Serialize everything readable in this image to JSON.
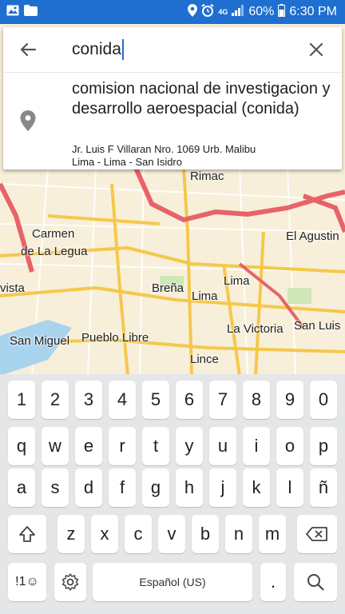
{
  "status_bar": {
    "network": "4G",
    "battery": "60%",
    "time": "6:30 PM",
    "icons": [
      "image-icon",
      "folder-icon",
      "location-icon",
      "alarm-icon",
      "signal-icon",
      "battery-icon"
    ]
  },
  "search": {
    "query": "conida",
    "back_icon": "arrow-left-icon",
    "clear_icon": "close-icon"
  },
  "result": {
    "icon": "location-pin-icon",
    "name": "comision nacional de investigacion y desarrollo aeroespacial (conida)",
    "address_line1": "Jr. Luis F Villaran Nro. 1069 Urb. Malibu",
    "address_line2": "Lima - Lima - San Isidro"
  },
  "map": {
    "labels": {
      "rimac": "Rimac",
      "carmen": "Carmen",
      "de_la_legua": "de La Legua",
      "el_agustin": "El Agustin",
      "vista": "vista",
      "brena": "Breña",
      "lima1": "Lima",
      "lima2": "Lima",
      "san_miguel": "San Miguel",
      "pueblo_libre": "Pueblo Libre",
      "la_victoria": "La Victoria",
      "san_luis": "San Luis",
      "lince": "Lince"
    },
    "colors": {
      "land": "#f7efd9",
      "major_road": "#e8626a",
      "road": "#f5c84b",
      "water": "#a8d4ee"
    }
  },
  "keyboard": {
    "numbers": [
      "1",
      "2",
      "3",
      "4",
      "5",
      "6",
      "7",
      "8",
      "9",
      "0"
    ],
    "row1": [
      "q",
      "w",
      "e",
      "r",
      "t",
      "y",
      "u",
      "i",
      "o",
      "p"
    ],
    "row2": [
      "a",
      "s",
      "d",
      "f",
      "g",
      "h",
      "j",
      "k",
      "l",
      "ñ"
    ],
    "row3": [
      "z",
      "x",
      "c",
      "v",
      "b",
      "n",
      "m"
    ],
    "symbols_key": "!1☺",
    "space_label": "Español (US)",
    "period_key": ".",
    "shift_icon": "shift-icon",
    "backspace_icon": "backspace-icon",
    "settings_icon": "gear-icon",
    "search_icon": "search-icon"
  }
}
